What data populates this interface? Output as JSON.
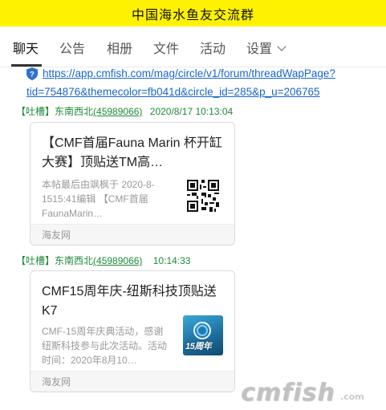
{
  "window": {
    "title": "中国海水鱼友交流群"
  },
  "tabs": [
    {
      "label": "聊天",
      "active": true
    },
    {
      "label": "公告",
      "active": false
    },
    {
      "label": "相册",
      "active": false
    },
    {
      "label": "文件",
      "active": false
    },
    {
      "label": "活动",
      "active": false
    },
    {
      "label": "设置",
      "active": false,
      "has_dropdown": true
    }
  ],
  "icons": {
    "link": "shield-icon",
    "dropdown": "chevron-down-icon",
    "qr": "qr-code-thumbnail",
    "k7": "cmf15-thumbnail"
  },
  "colors": {
    "title_bar": "#fff200",
    "link": "#1a66cc",
    "meta": "#1f8a3a",
    "muted": "#999999"
  },
  "chat": {
    "link_message": {
      "line1": "https://app.cmfish.com/mag/circle/v1/forum/threadWapPage?",
      "line2": "tid=754876&themecolor=fb041d&circle_id=285&p_u=206765"
    },
    "messages": [
      {
        "tag": "【吐槽】",
        "sender": "东南西北",
        "uid": "(45989066)",
        "time": "2020/8/17 10:13:04",
        "card": {
          "title": "【CMF首届Fauna Marin 杯开缸大赛】顶贴送TM高…",
          "desc": "本帖最后由飒枫于 2020-8-1515:41编辑 【CMF首届FaunaMarin…",
          "source": "海友网"
        }
      },
      {
        "tag": "【吐槽】",
        "sender": "东南西北",
        "uid": "(45989066)",
        "time": "10:14:33",
        "card": {
          "title": "CMF15周年庆-纽斯科技顶贴送K7",
          "desc": "CMF-15周年庆典活动，感谢纽斯科技参与此次活动。活动时间：2020年8月10…",
          "thumb_badge": "15周年",
          "source": "海友网"
        }
      }
    ]
  },
  "watermark": {
    "text": "cmfish",
    "suffix": ".com"
  }
}
